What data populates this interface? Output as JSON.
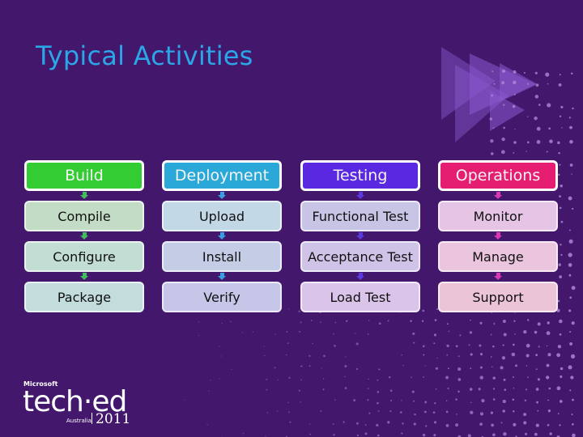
{
  "slide": {
    "title": "Typical Activities",
    "background_color": "#43186c",
    "title_color": "#2ba6e8"
  },
  "columns": [
    {
      "header": "Build",
      "header_color": "#33cc33",
      "arrow_color": "#3fbf5a",
      "items": [
        "Compile",
        "Configure",
        "Package"
      ],
      "item_colors": [
        "#c3dcc6",
        "#c2ddd4",
        "#c3dcdc"
      ]
    },
    {
      "header": "Deployment",
      "header_color": "#2aa8d8",
      "arrow_color": "#3a9ee0",
      "items": [
        "Upload",
        "Install",
        "Verify"
      ],
      "item_colors": [
        "#c3d8e6",
        "#c4cce6",
        "#c6c6e8"
      ]
    },
    {
      "header": "Testing",
      "header_color": "#5a28e0",
      "arrow_color": "#5a3ae0",
      "items": [
        "Functional Test",
        "Acceptance Test",
        "Load Test"
      ],
      "item_colors": [
        "#c8c4e6",
        "#cfc4e8",
        "#dac4ea"
      ]
    },
    {
      "header": "Operations",
      "header_color": "#e61e72",
      "arrow_color": "#d838b0",
      "items": [
        "Monitor",
        "Manage",
        "Support"
      ],
      "item_colors": [
        "#e6c4e6",
        "#ebc4de",
        "#ecc4d8"
      ]
    }
  ],
  "logo": {
    "brand": "Microsoft",
    "name": "tech·ed",
    "region": "Australia",
    "year": "2011"
  }
}
